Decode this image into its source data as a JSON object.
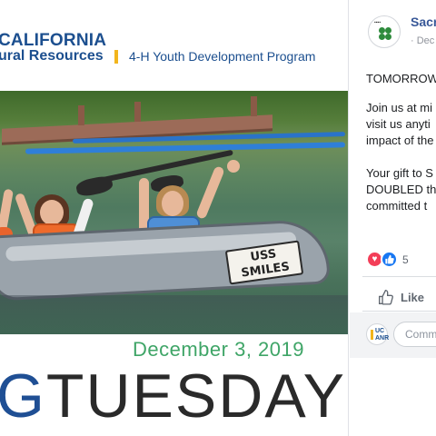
{
  "image_post": {
    "banner": {
      "org_line1": "CALIFORNIA",
      "org_line2": "ural Resources",
      "program": "4-H Youth Development Program"
    },
    "canoe_sign": "USS SMILES",
    "date": "December 3, 2019",
    "headline_first": "G",
    "headline_rest": "TUESDAY"
  },
  "fb_post": {
    "page_name": "Sacr",
    "post_date": "· Dec",
    "paragraphs": [
      [
        "TOMORROW"
      ],
      [
        "Join us at mi",
        "visit us anyti",
        "impact of the"
      ],
      [
        "Your gift to S",
        "DOUBLED th",
        "committed t"
      ]
    ],
    "reaction_count": "5",
    "like_label": "Like",
    "comment_placeholder": "Comm"
  },
  "colors": {
    "uc_blue": "#1c4f8f",
    "uc_gold": "#f2b51d",
    "date_green": "#3fa567",
    "fb_link": "#385898",
    "love_red": "#f33e58",
    "like_blue": "#1877f2"
  },
  "icons": {
    "love": "heart-icon",
    "like": "thumbs-up-icon",
    "avatar": "4h-clover-icon"
  }
}
